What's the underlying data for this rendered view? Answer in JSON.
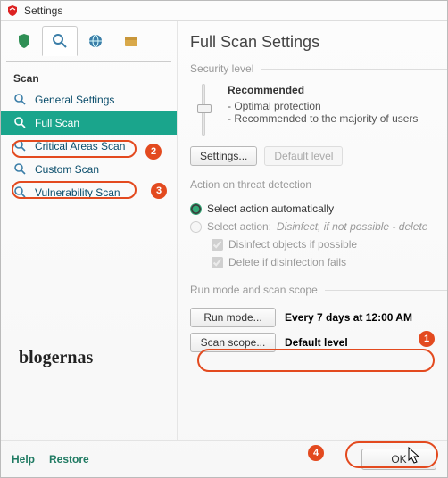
{
  "window": {
    "title": "Settings"
  },
  "tabs": {
    "shield": "shield",
    "search": "search",
    "globe": "globe",
    "folder": "folder"
  },
  "sidebar": {
    "section_label": "Scan",
    "items": [
      {
        "label": "General Settings"
      },
      {
        "label": "Full Scan"
      },
      {
        "label": "Critical Areas Scan"
      },
      {
        "label": "Custom Scan"
      },
      {
        "label": "Vulnerability Scan"
      }
    ]
  },
  "brand": "blogernas",
  "content": {
    "title": "Full Scan Settings",
    "security": {
      "legend": "Security level",
      "recommended": "Recommended",
      "bullets": [
        "- Optimal protection",
        "- Recommended to the majority of users"
      ],
      "settings_btn": "Settings...",
      "default_btn": "Default level"
    },
    "threat": {
      "legend": "Action on threat detection",
      "auto_label": "Select action automatically",
      "select_label": "Select action:",
      "select_value": "Disinfect, if not possible - delete",
      "chk1": "Disinfect objects if possible",
      "chk2": "Delete if disinfection fails"
    },
    "runmode": {
      "legend": "Run mode and scan scope",
      "runmode_btn": "Run mode...",
      "runmode_value": "Every 7 days at 12:00 AM",
      "scope_btn": "Scan scope...",
      "scope_value": "Default level"
    }
  },
  "footer": {
    "help": "Help",
    "restore": "Restore",
    "ok": "OK"
  },
  "annotations": {
    "n1": "1",
    "n2": "2",
    "n3": "3",
    "n4": "4"
  }
}
